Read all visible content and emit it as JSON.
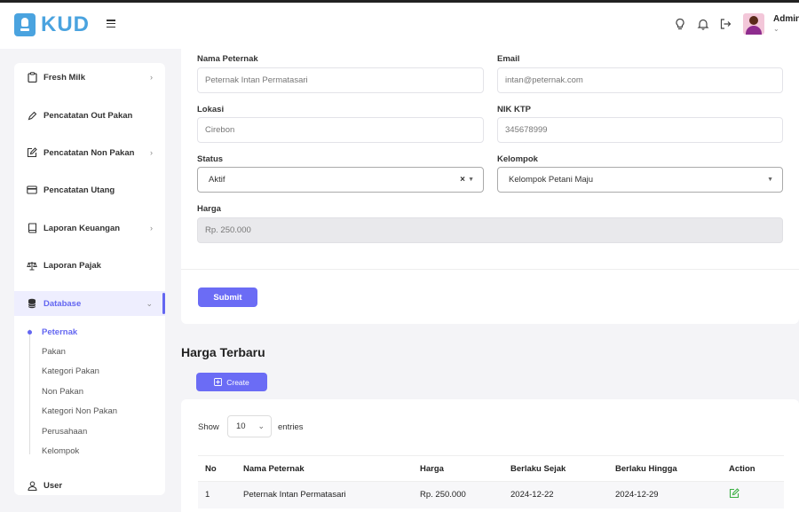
{
  "header": {
    "logo_text": "KUD",
    "admin_name": "Admin",
    "admin_caret": "⌄"
  },
  "sidebar": {
    "items": [
      {
        "label": "Fresh Milk",
        "icon": "clipboard-icon",
        "chevron": "›"
      },
      {
        "label": "Pencatatan Out Pakan",
        "icon": "pencil-icon"
      },
      {
        "label": "Pencatatan Non Pakan",
        "icon": "edit-square-icon",
        "chevron": "›"
      },
      {
        "label": "Pencatatan Utang",
        "icon": "credit-card-icon"
      },
      {
        "label": "Laporan Keuangan",
        "icon": "book-icon",
        "chevron": "›"
      },
      {
        "label": "Laporan Pajak",
        "icon": "scale-icon"
      },
      {
        "label": "Database",
        "icon": "database-icon",
        "chevron": "⌄"
      },
      {
        "label": "User",
        "icon": "user-icon"
      }
    ],
    "database_sub": [
      "Peternak",
      "Pakan",
      "Kategori Pakan",
      "Non Pakan",
      "Kategori Non Pakan",
      "Perusahaan",
      "Kelompok"
    ]
  },
  "form": {
    "nama_label": "Nama Peternak",
    "nama_value": "Peternak Intan Permatasari",
    "email_label": "Email",
    "email_value": "intan@peternak.com",
    "lokasi_label": "Lokasi",
    "lokasi_value": "Cirebon",
    "nik_label": "NIK KTP",
    "nik_value": "345678999",
    "status_label": "Status",
    "status_value": "Aktif",
    "kelompok_label": "Kelompok",
    "kelompok_value": "Kelompok Petani Maju",
    "harga_label": "Harga",
    "harga_value": "Rp. 250.000",
    "submit_label": "Submit"
  },
  "harga_section": {
    "title": "Harga Terbaru",
    "create_label": "Create",
    "show_label": "Show",
    "entries_value": "10",
    "entries_label": "entries",
    "columns": [
      "No",
      "Nama Peternak",
      "Harga",
      "Berlaku Sejak",
      "Berlaku Hingga",
      "Action"
    ],
    "rows": [
      {
        "no": "1",
        "nama": "Peternak Intan Permatasari",
        "harga": "Rp. 250.000",
        "sejak": "2024-12-22",
        "hingga": "2024-12-29"
      }
    ]
  },
  "colors": {
    "accent": "#6366f1",
    "button": "#6b6cf5",
    "logo": "#4aa3df",
    "edit_icon": "#3cb043"
  }
}
